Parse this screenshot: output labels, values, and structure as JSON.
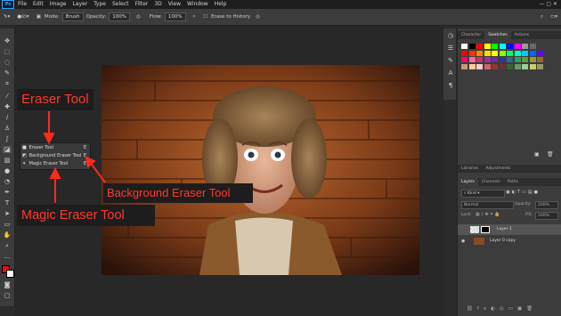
{
  "menu": {
    "app_badge": "Ps",
    "items": [
      "File",
      "Edit",
      "Image",
      "Layer",
      "Type",
      "Select",
      "Filter",
      "3D",
      "View",
      "Window",
      "Help"
    ]
  },
  "options_bar": {
    "brush_size": "65",
    "mode_label": "Mode:",
    "mode_value": "Brush",
    "opacity_label": "Opacity:",
    "opacity_value": "100%",
    "flow_label": "Flow:",
    "flow_value": "100%",
    "erase_history_label": "Erase to History"
  },
  "tool_flyout": {
    "items": [
      {
        "label": "Eraser Tool",
        "key": "E"
      },
      {
        "label": "Background Eraser Tool",
        "key": "E"
      },
      {
        "label": "Magic Eraser Tool",
        "key": "E"
      }
    ]
  },
  "callouts": {
    "eraser": "Eraser Tool",
    "background_eraser": "Background Eraser Tool",
    "magic_eraser": "Magic Eraser Tool"
  },
  "panels": {
    "top_tabs": [
      "Character",
      "Swatches",
      "Actions"
    ],
    "top_active": "Swatches",
    "mid_tabs": [
      "Libraries",
      "Adjustments"
    ],
    "layer_tabs": [
      "Layers",
      "Channels",
      "Paths"
    ],
    "kind_label": "Kind",
    "blend_mode": "Normal",
    "opacity_label": "Opacity:",
    "opacity_value": "100%",
    "lock_label": "Lock:",
    "fill_label": "Fill:",
    "fill_value": "100%",
    "layers": [
      {
        "name": "Layer 1",
        "selected": true
      },
      {
        "name": "Layer 0 copy",
        "selected": false
      }
    ]
  },
  "colors": {
    "accent_red": "#ff3a2e",
    "swatches": [
      "#ffffff",
      "#000000",
      "#ff0000",
      "#ffff00",
      "#00ff00",
      "#00ffff",
      "#0000ff",
      "#ff00ff",
      "#9a9a9a",
      "#6a6a6a",
      "#3c3c3c",
      "#ff0000",
      "#ff3300",
      "#ff8800",
      "#ffdd00",
      "#ffff00",
      "#88ff00",
      "#00ff66",
      "#00ffcc",
      "#00ccff",
      "#0066ff",
      "#6600ff",
      "#ff0066",
      "#ff66aa",
      "#cc3366",
      "#993399",
      "#663399",
      "#333399",
      "#336699",
      "#339966",
      "#669933",
      "#999933",
      "#996633",
      "#cc9966",
      "#ffcc99",
      "#ffcccc",
      "#cc6666",
      "#993333",
      "#663333",
      "#336633",
      "#669966",
      "#99cc99",
      "#cccc66",
      "#999966"
    ]
  }
}
